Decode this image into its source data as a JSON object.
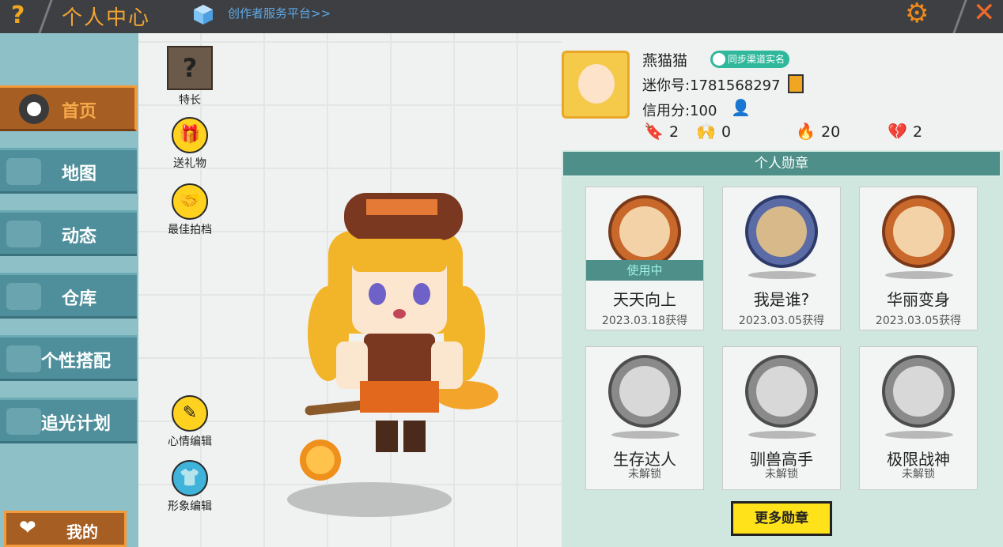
{
  "header": {
    "help_glyph": "?",
    "title": "个人中心",
    "creator_link": "创作者服务平台>>",
    "settings_glyph": "⚙",
    "close_glyph": "✕"
  },
  "sidebar": {
    "items": [
      {
        "label": "首页",
        "icon": "toggle-icon"
      },
      {
        "label": "地图",
        "icon": "map-icon"
      },
      {
        "label": "动态",
        "icon": "bell-icon"
      },
      {
        "label": "仓库",
        "icon": "warehouse-icon"
      },
      {
        "label": "个性搭配",
        "icon": "wardrobe-icon"
      },
      {
        "label": "追光计划",
        "icon": "light-icon"
      }
    ],
    "mine_label": "我的"
  },
  "actions": {
    "specialty": "特长",
    "gift": "送礼物",
    "partner": "最佳拍档",
    "mood_edit": "心情编辑",
    "look_edit": "形象编辑"
  },
  "profile": {
    "name": "燕猫猫",
    "realname_badge": "同步渠道实名",
    "mini_id": "迷你号:1781568297",
    "credit": "信用分:100",
    "stats": [
      {
        "icon": "bookmark-plus-icon",
        "value": "2"
      },
      {
        "icon": "fans-icon",
        "value": "0"
      },
      {
        "icon": "fire-icon",
        "value": "20"
      },
      {
        "icon": "broken-heart-icon",
        "value": "2"
      }
    ]
  },
  "medals": {
    "header": "个人勋章",
    "in_use_label": "使用中",
    "items": [
      {
        "name": "天天向上",
        "sub": "2023.03.18获得"
      },
      {
        "name": "我是谁?",
        "sub": "2023.03.05获得"
      },
      {
        "name": "华丽变身",
        "sub": "2023.03.05获得"
      },
      {
        "name": "生存达人",
        "sub": "未解锁"
      },
      {
        "name": "驯兽高手",
        "sub": "未解锁"
      },
      {
        "name": "极限战神",
        "sub": "未解锁"
      }
    ],
    "more_button": "更多勋章"
  }
}
